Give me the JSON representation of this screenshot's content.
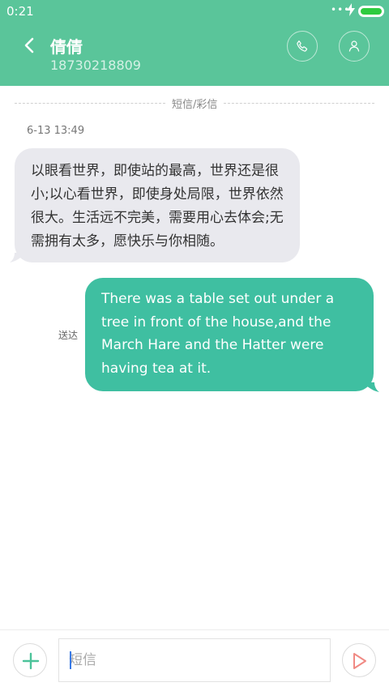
{
  "status_bar": {
    "time": "0:21",
    "dots": "•••",
    "battery_color": "#2ecb3f"
  },
  "header": {
    "background_color": "#5ac59a",
    "contact_name": "倩倩",
    "contact_number": "18730218809",
    "icons": [
      "back-icon",
      "phone-icon",
      "person-icon"
    ]
  },
  "thread": {
    "channel_label": "短信/彩信",
    "messages": [
      {
        "direction": "incoming",
        "timestamp": "6-13 13:49",
        "text": "以眼看世界，即使站的最高，世界还是很小;以心看世界，即使身处局限，世界依然很大。生活远不完美，需要用心去体会;无需拥有太多，愿快乐与你相随。"
      },
      {
        "direction": "outgoing",
        "status": "送达",
        "bubble_color": "#3fbfa1",
        "text": "There was a table set out under a tree in front of the house,and the March Hare and the Hatter were having tea at it."
      }
    ]
  },
  "composer": {
    "placeholder": "短信",
    "value": "",
    "icons": [
      "add-icon",
      "send-icon"
    ]
  }
}
